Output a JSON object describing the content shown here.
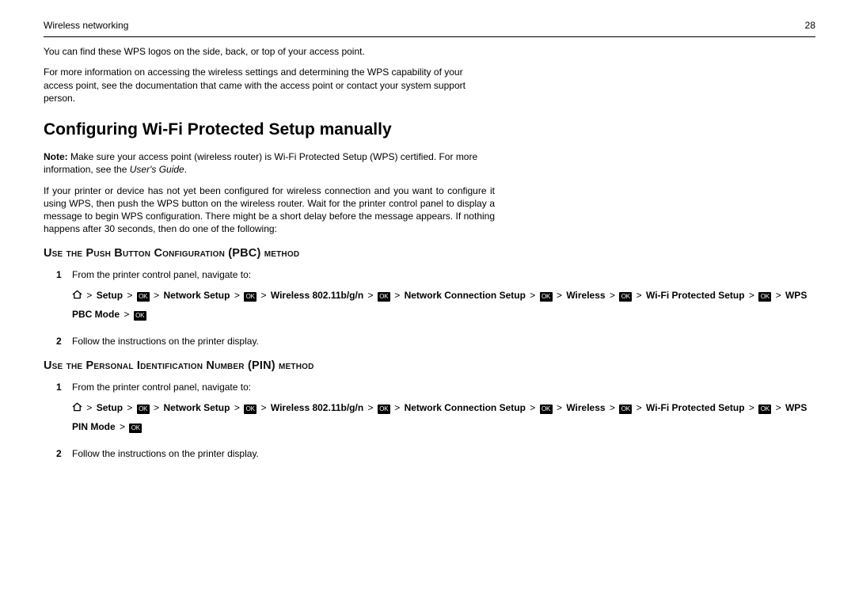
{
  "header": {
    "left": "Wireless networking",
    "right": "28"
  },
  "intro": {
    "p1": "You can find these WPS logos on the side, back, or top of your access point.",
    "p2": "For more information on accessing the wireless settings and determining the WPS capability of your access point, see the documentation that came with the access point or contact your system support person."
  },
  "title": "Configuring Wi-Fi Protected Setup manually",
  "note_prefix": "Note:",
  "note_body": " Make sure your access point (wireless router) is Wi-Fi Protected Setup (WPS) certified. For more information, see the ",
  "note_italic": "User's Guide",
  "note_end": ".",
  "body_para": "If your printer or device has not yet been configured for wireless connection and you want to configure it using WPS, then push the WPS button on the wireless router. Wait for the printer control panel to display a message to begin WPS configuration. There might be a short delay before the message appears. If nothing happens after 30 seconds, then do one of the following:",
  "section_pbc": {
    "heading": "Use the Push Button Configuration (PBC) method",
    "step1_text": "From the printer control panel, navigate to:",
    "step2_text": "Follow the instructions on the printer display."
  },
  "section_pin": {
    "heading": "Use the Personal Identification Number (PIN) method",
    "step1_text": "From the printer control panel, navigate to:",
    "step2_text": "Follow the instructions on the printer display."
  },
  "nav": {
    "ok": "OK",
    "setup": "Setup",
    "network_setup": "Network Setup",
    "wireless_band": "Wireless 802.11b/g/n",
    "network_connection_setup": "Network Connection Setup",
    "wireless": "Wireless",
    "wifi_protected_setup": "Wi-Fi Protected Setup",
    "wps_pbc_mode": "WPS PBC Mode",
    "wps_pin_mode": "WPS PIN Mode"
  }
}
